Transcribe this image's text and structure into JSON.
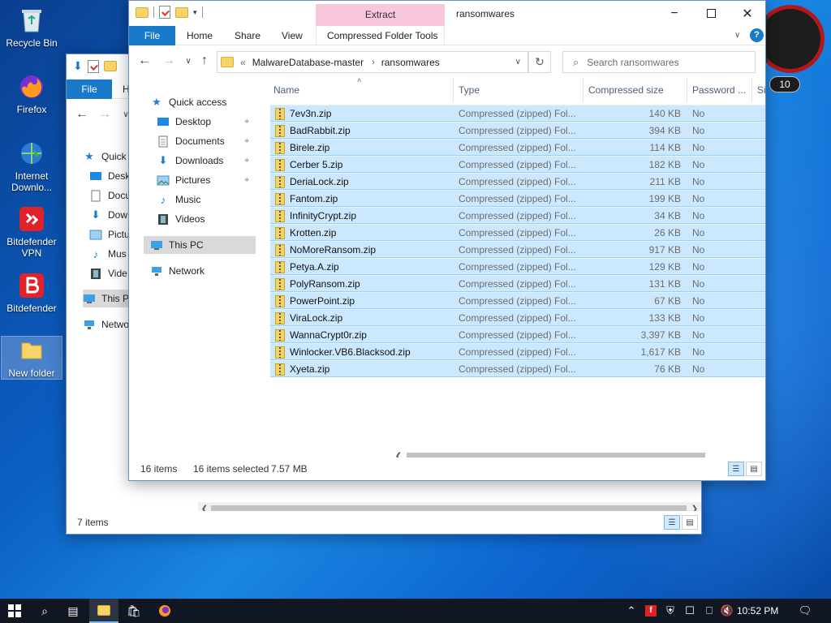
{
  "desktop": {
    "icons": [
      {
        "label": "Recycle Bin",
        "icon": "recycle-bin-icon"
      },
      {
        "label": "Firefox",
        "icon": "firefox-icon"
      },
      {
        "label": "Internet Downlo...",
        "icon": "internet-download-manager-icon"
      },
      {
        "label": "Bitdefender VPN",
        "icon": "bitdefender-vpn-icon"
      },
      {
        "label": "Bitdefender",
        "icon": "bitdefender-icon"
      },
      {
        "label": "New folder",
        "icon": "folder-icon"
      }
    ],
    "gauge_value": "10"
  },
  "back_window": {
    "file_tab": "File",
    "home_tab_partial": "H",
    "nav_items": [
      "Quick",
      "Desk",
      "Docu",
      "Dow",
      "Pictu",
      "Mus",
      "Vide",
      "This P",
      "Netwo"
    ],
    "status": "7 items"
  },
  "front_window": {
    "title": "ransomwares",
    "contextual_group": "Extract",
    "tabs": {
      "file": "File",
      "home": "Home",
      "share": "Share",
      "view": "View",
      "tools": "Compressed Folder Tools"
    },
    "address": {
      "prefix": "«",
      "crumb1": "MalwareDatabase-master",
      "crumb2": "ransomwares"
    },
    "search_placeholder": "Search ransomwares",
    "nav": {
      "quick_access": "Quick access",
      "desktop": "Desktop",
      "documents": "Documents",
      "downloads": "Downloads",
      "pictures": "Pictures",
      "music": "Music",
      "videos": "Videos",
      "this_pc": "This PC",
      "network": "Network"
    },
    "columns": {
      "name": "Name",
      "type": "Type",
      "size": "Compressed size",
      "password": "Password ...",
      "more": "Si"
    },
    "files": [
      {
        "name": "7ev3n.zip",
        "type": "Compressed (zipped) Fol...",
        "size": "140 KB",
        "password": "No"
      },
      {
        "name": "BadRabbit.zip",
        "type": "Compressed (zipped) Fol...",
        "size": "394 KB",
        "password": "No"
      },
      {
        "name": "Birele.zip",
        "type": "Compressed (zipped) Fol...",
        "size": "114 KB",
        "password": "No"
      },
      {
        "name": "Cerber 5.zip",
        "type": "Compressed (zipped) Fol...",
        "size": "182 KB",
        "password": "No"
      },
      {
        "name": "DeriaLock.zip",
        "type": "Compressed (zipped) Fol...",
        "size": "211 KB",
        "password": "No"
      },
      {
        "name": "Fantom.zip",
        "type": "Compressed (zipped) Fol...",
        "size": "199 KB",
        "password": "No"
      },
      {
        "name": "InfinityCrypt.zip",
        "type": "Compressed (zipped) Fol...",
        "size": "34 KB",
        "password": "No"
      },
      {
        "name": "Krotten.zip",
        "type": "Compressed (zipped) Fol...",
        "size": "26 KB",
        "password": "No"
      },
      {
        "name": "NoMoreRansom.zip",
        "type": "Compressed (zipped) Fol...",
        "size": "917 KB",
        "password": "No"
      },
      {
        "name": "Petya.A.zip",
        "type": "Compressed (zipped) Fol...",
        "size": "129 KB",
        "password": "No"
      },
      {
        "name": "PolyRansom.zip",
        "type": "Compressed (zipped) Fol...",
        "size": "131 KB",
        "password": "No"
      },
      {
        "name": "PowerPoint.zip",
        "type": "Compressed (zipped) Fol...",
        "size": "67 KB",
        "password": "No"
      },
      {
        "name": "ViraLock.zip",
        "type": "Compressed (zipped) Fol...",
        "size": "133 KB",
        "password": "No"
      },
      {
        "name": "WannaCrypt0r.zip",
        "type": "Compressed (zipped) Fol...",
        "size": "3,397 KB",
        "password": "No"
      },
      {
        "name": "Winlocker.VB6.Blacksod.zip",
        "type": "Compressed (zipped) Fol...",
        "size": "1,617 KB",
        "password": "No"
      },
      {
        "name": "Xyeta.zip",
        "type": "Compressed (zipped) Fol...",
        "size": "76 KB",
        "password": "No"
      }
    ],
    "status": {
      "count": "16 items",
      "selected": "16 items selected",
      "size": "7.57 MB"
    }
  },
  "taskbar": {
    "clock": "10:52 PM",
    "colors": {
      "bg": "#101723",
      "accent": "#76b9ed"
    }
  }
}
